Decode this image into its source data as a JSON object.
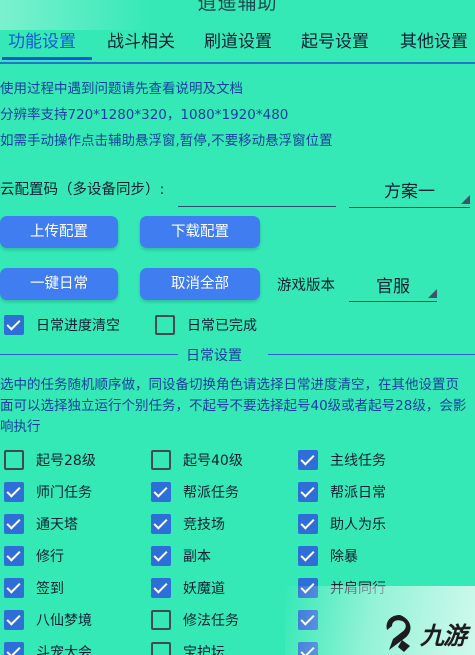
{
  "app_title": "逍遥辅助",
  "tabs": [
    {
      "label": "功能设置",
      "active": true
    },
    {
      "label": "战斗相关",
      "active": false
    },
    {
      "label": "刷道设置",
      "active": false
    },
    {
      "label": "起号设置",
      "active": false
    },
    {
      "label": "其他设置",
      "active": false
    }
  ],
  "info_lines": [
    "使用过程中遇到问题请先查看说明及文档",
    "分辨率支持720*1280*320，1080*1920*480",
    "如需手动操作点击辅助悬浮窗,暂停,不要移动悬浮窗位置"
  ],
  "cloud": {
    "label": "云配置码（多设备同步）:",
    "input_value": "",
    "scheme_selected": "方案一"
  },
  "buttons": {
    "upload": "上传配置",
    "download": "下载配置",
    "one_click_daily": "一键日常",
    "cancel_all": "取消全部"
  },
  "game_version": {
    "label": "游戏版本",
    "selected": "官服"
  },
  "daily_options": [
    {
      "label": "日常进度清空",
      "checked": true
    },
    {
      "label": "日常已完成",
      "checked": false
    }
  ],
  "daily_section": {
    "title": "日常设置",
    "description": "选中的任务随机顺序做，同设备切换角色请选择日常进度清空，在其他设置页面可以选择独立运行个别任务，不起号不要选择起号40级或者起号28级，会影响执行"
  },
  "tasks": [
    {
      "label": "起号28级",
      "checked": false
    },
    {
      "label": "起号40级",
      "checked": false
    },
    {
      "label": "主线任务",
      "checked": true
    },
    {
      "label": "师门任务",
      "checked": true
    },
    {
      "label": "帮派任务",
      "checked": true
    },
    {
      "label": "帮派日常",
      "checked": true
    },
    {
      "label": "通天塔",
      "checked": true
    },
    {
      "label": "竞技场",
      "checked": true
    },
    {
      "label": "助人为乐",
      "checked": true
    },
    {
      "label": "修行",
      "checked": true
    },
    {
      "label": "副本",
      "checked": true
    },
    {
      "label": "除暴",
      "checked": true
    },
    {
      "label": "签到",
      "checked": true
    },
    {
      "label": "妖魔道",
      "checked": true
    },
    {
      "label": "并肩同行",
      "checked": true
    },
    {
      "label": "八仙梦境",
      "checked": true
    },
    {
      "label": "修法任务",
      "checked": false
    },
    {
      "label": "",
      "checked": true
    },
    {
      "label": "斗宠大会",
      "checked": true
    },
    {
      "label": "宝护坛",
      "checked": false
    },
    {
      "label": "",
      "checked": true
    }
  ],
  "watermark": "九游",
  "colors": {
    "background": "#35e9b6",
    "accent": "#1257d6",
    "button": "#3f7df0",
    "checkbox": "#2d6fd6",
    "info_text": "#1a3e9e"
  }
}
